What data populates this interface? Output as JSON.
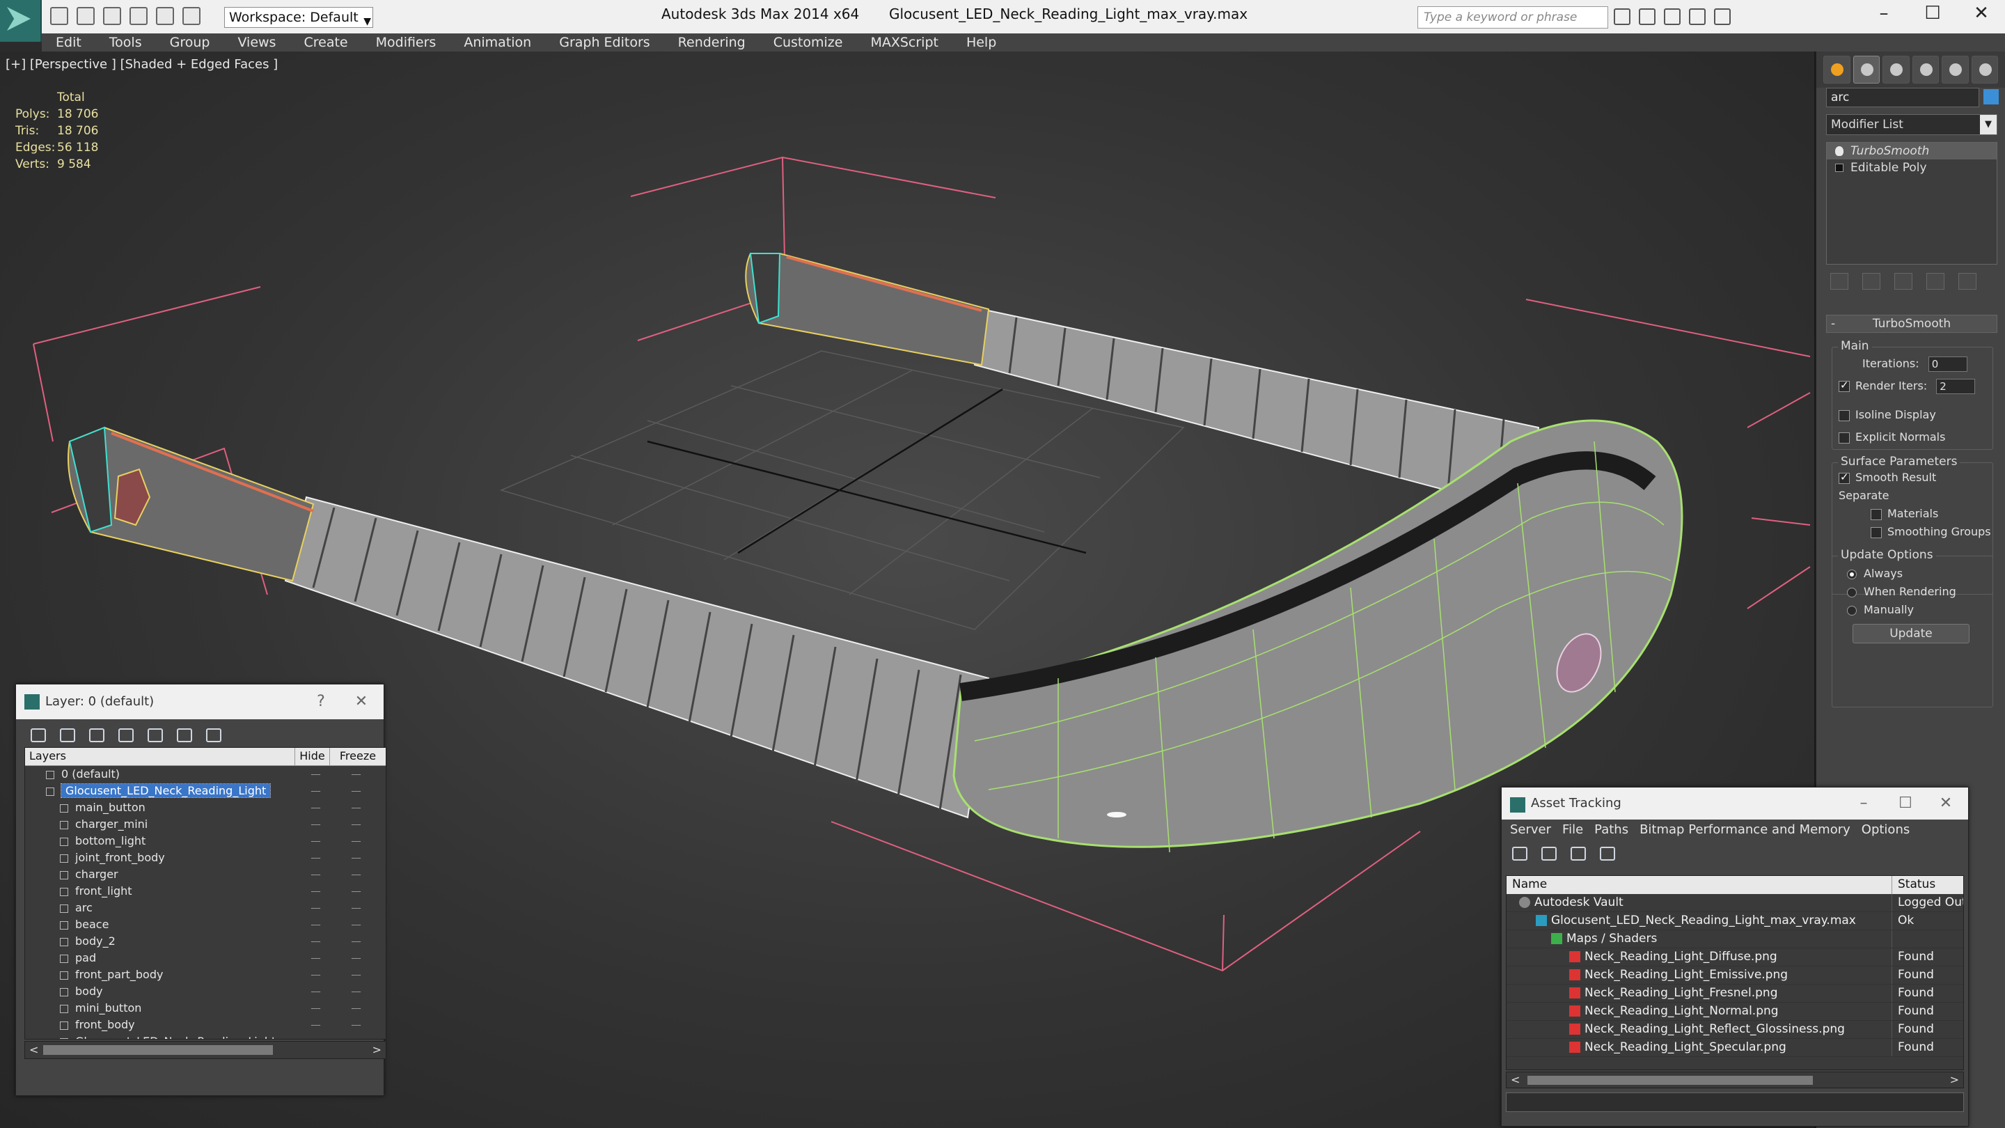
{
  "titlebar": {
    "workspace": "Workspace: Default",
    "app_title": "Autodesk 3ds Max  2014 x64",
    "file_title": "Glocusent_LED_Neck_Reading_Light_max_vray.max",
    "search_placeholder": "Type a keyword or phrase",
    "minimize": "–",
    "maximize": "☐",
    "close": "✕"
  },
  "menu": [
    "Edit",
    "Tools",
    "Group",
    "Views",
    "Create",
    "Modifiers",
    "Animation",
    "Graph Editors",
    "Rendering",
    "Customize",
    "MAXScript",
    "Help"
  ],
  "viewport": {
    "label": "[+] [Perspective ] [Shaded + Edged Faces ]",
    "stats": {
      "header": "Total",
      "rows": [
        {
          "k": "Polys:",
          "v": "18 706"
        },
        {
          "k": "Tris:",
          "v": "18 706"
        },
        {
          "k": "Edges:",
          "v": "56 118"
        },
        {
          "k": "Verts:",
          "v": "9 584"
        }
      ]
    }
  },
  "command_panel": {
    "object_name": "arc",
    "modifier_list": "Modifier List",
    "stack": [
      "TurboSmooth",
      "Editable Poly"
    ],
    "rollout_title": "TurboSmooth",
    "main_group": "Main",
    "iterations_label": "Iterations:",
    "iterations_value": "0",
    "render_iters_label": "Render Iters:",
    "render_iters_value": "2",
    "isoline": "Isoline Display",
    "explicit_normals": "Explicit Normals",
    "surface_group": "Surface Parameters",
    "smooth_result": "Smooth Result",
    "separate": "Separate",
    "materials": "Materials",
    "smoothing_groups": "Smoothing Groups",
    "update_group": "Update Options",
    "always": "Always",
    "when_rendering": "When Rendering",
    "manually": "Manually",
    "update_btn": "Update"
  },
  "layer_manager": {
    "title": "Layer: 0 (default)",
    "help": "?",
    "close": "✕",
    "col_layers": "Layers",
    "col_hide": "Hide",
    "col_freeze": "Freeze",
    "rows": [
      {
        "name": "0 (default)",
        "level": 0
      },
      {
        "name": "Glocusent_LED_Neck_Reading_Light",
        "level": 0
      },
      {
        "name": "main_button",
        "level": 1
      },
      {
        "name": "charger_mini",
        "level": 1
      },
      {
        "name": "bottom_light",
        "level": 1
      },
      {
        "name": "joint_front_body",
        "level": 1
      },
      {
        "name": "charger",
        "level": 1
      },
      {
        "name": "front_light",
        "level": 1
      },
      {
        "name": "arc",
        "level": 1
      },
      {
        "name": "beace",
        "level": 1
      },
      {
        "name": "body_2",
        "level": 1
      },
      {
        "name": "pad",
        "level": 1
      },
      {
        "name": "front_part_body",
        "level": 1
      },
      {
        "name": "body",
        "level": 1
      },
      {
        "name": "mini_button",
        "level": 1
      },
      {
        "name": "front_body",
        "level": 1
      },
      {
        "name": "Glocusent_LED_Neck_Reading_Light",
        "level": 1
      }
    ],
    "dash": "----"
  },
  "asset_tracking": {
    "title": "Asset Tracking",
    "menu": [
      "Server",
      "File",
      "Paths",
      "Bitmap Performance and Memory",
      "Options"
    ],
    "col_name": "Name",
    "col_status": "Status",
    "rows": [
      {
        "name": "Autodesk Vault",
        "status": "Logged Out",
        "icon": "vault",
        "indent": 18
      },
      {
        "name": "Glocusent_LED_Neck_Reading_Light_max_vray.max",
        "status": "Ok",
        "icon": "max",
        "indent": 42
      },
      {
        "name": "Maps / Shaders",
        "status": "",
        "icon": "maps",
        "indent": 64
      },
      {
        "name": "Neck_Reading_Light_Diffuse.png",
        "status": "Found",
        "icon": "png",
        "indent": 90
      },
      {
        "name": "Neck_Reading_Light_Emissive.png",
        "status": "Found",
        "icon": "png",
        "indent": 90
      },
      {
        "name": "Neck_Reading_Light_Fresnel.png",
        "status": "Found",
        "icon": "png",
        "indent": 90
      },
      {
        "name": "Neck_Reading_Light_Normal.png",
        "status": "Found",
        "icon": "png",
        "indent": 90
      },
      {
        "name": "Neck_Reading_Light_Reflect_Glossiness.png",
        "status": "Found",
        "icon": "png",
        "indent": 90
      },
      {
        "name": "Neck_Reading_Light_Specular.png",
        "status": "Found",
        "icon": "png",
        "indent": 90
      }
    ]
  }
}
